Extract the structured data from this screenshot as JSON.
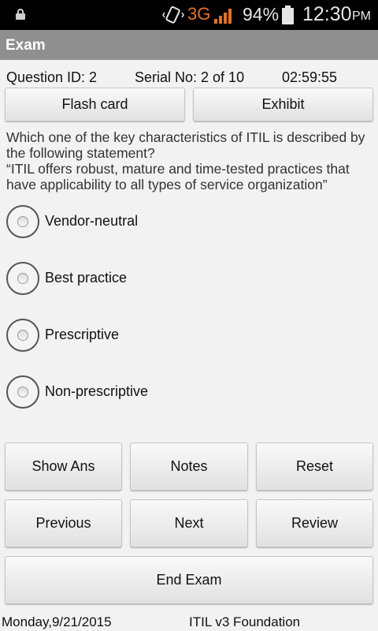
{
  "status_bar": {
    "network": "3G",
    "battery_percent": "94%",
    "time": "12:30",
    "ampm": "PM",
    "icons": [
      "lock-icon",
      "vibrate-icon",
      "signal-icon",
      "battery-icon"
    ]
  },
  "app_bar": {
    "title": "Exam"
  },
  "exam_info": {
    "question_id": "Question ID: 2",
    "serial_no": "Serial No: 2 of 10",
    "timer": "02:59:55"
  },
  "top_buttons": {
    "flash_card": "Flash card",
    "exhibit": "Exhibit"
  },
  "question": {
    "prompt": "Which one of the key characteristics of ITIL is described by the following statement?",
    "statement": "“ITIL offers robust, mature and time-tested practices that have applicability to all types of service organization”"
  },
  "options": [
    {
      "label": "Vendor-neutral",
      "selected": false
    },
    {
      "label": "Best practice",
      "selected": false
    },
    {
      "label": "Prescriptive",
      "selected": false
    },
    {
      "label": "Non-prescriptive",
      "selected": false
    }
  ],
  "actions": {
    "show_ans": "Show Ans",
    "notes": "Notes",
    "reset": "Reset",
    "previous": "Previous",
    "next": "Next",
    "review": "Review",
    "end_exam": "End Exam"
  },
  "footer": {
    "date": "Monday,9/21/2015",
    "course": "ITIL v3 Foundation"
  },
  "colors": {
    "status_bar": "#000000",
    "title_bar": "#8f8f8f",
    "background": "#f2f2f2",
    "network_accent": "#e8711a"
  }
}
